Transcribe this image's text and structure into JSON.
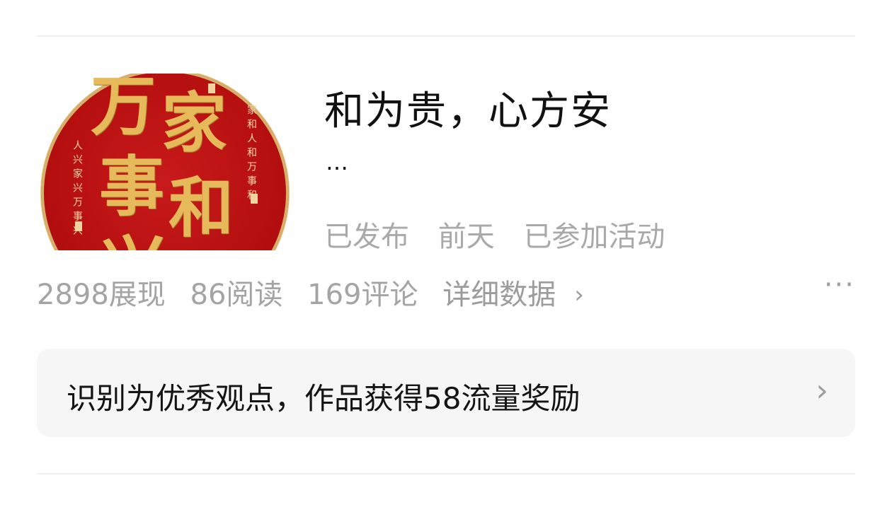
{
  "article": {
    "title": "和为贵，心方安",
    "ellipsis": "…",
    "status": "已发布",
    "time": "前天",
    "activity": "已参加活动",
    "thumbnail": {
      "big_chars": [
        "家",
        "和",
        "万",
        "事",
        "兴"
      ],
      "small_right": "家和人和万事和",
      "small_left": "人兴家兴万事兴",
      "background_color": "#b50f10",
      "gold_color": "#e6b95a"
    }
  },
  "stats": {
    "views": "2898展现",
    "reads": "86阅读",
    "comments": "169评论",
    "detail_link": "详细数据",
    "detail_chevron": "›",
    "more": "···"
  },
  "banner": {
    "text": "识别为优秀观点，作品获得58流量奖励",
    "chevron": "›"
  }
}
